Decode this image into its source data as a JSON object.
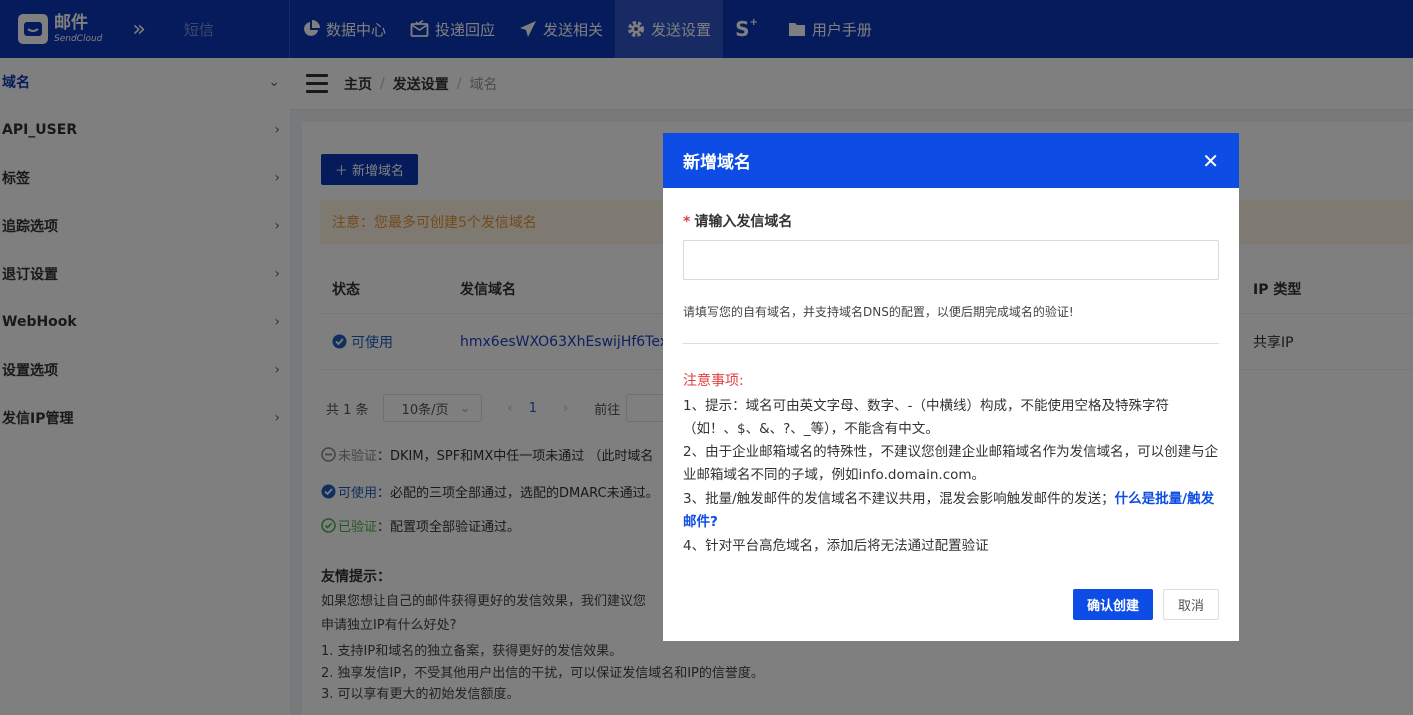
{
  "brand": {
    "name": "邮件",
    "sub": "SendCloud",
    "toggle": "»",
    "sms": "短信"
  },
  "topnav": [
    {
      "label": "数据中心",
      "icon": "pie-chart-icon"
    },
    {
      "label": "投递回应",
      "icon": "mail-check-icon"
    },
    {
      "label": "发送相关",
      "icon": "paper-plane-icon"
    },
    {
      "label": "发送设置",
      "icon": "gear-icon",
      "active": true
    },
    {
      "label": "",
      "icon": "s-plus-icon",
      "glyph": "S"
    },
    {
      "label": "用户手册",
      "icon": "folder-icon"
    }
  ],
  "sidebar": {
    "items": [
      {
        "label": "域名",
        "active": true,
        "chevron": "⌄"
      },
      {
        "label": "API_USER",
        "chevron": "›"
      },
      {
        "label": "标签",
        "chevron": "›"
      },
      {
        "label": "追踪选项",
        "chevron": "›"
      },
      {
        "label": "退订设置",
        "chevron": "›"
      },
      {
        "label": "WebHook",
        "chevron": "›"
      },
      {
        "label": "设置选项",
        "chevron": "›"
      },
      {
        "label": "发信IP管理",
        "chevron": "›"
      }
    ]
  },
  "breadcrumb": {
    "home": "主页",
    "section": "发送设置",
    "current": "域名",
    "sep": "/"
  },
  "main": {
    "add_button": "＋ 新增域名",
    "notice": "注意：您最多可创建5个发信域名",
    "table": {
      "headers": {
        "status": "状态",
        "domain": "发信域名",
        "ip_type": "IP 类型"
      },
      "rows": [
        {
          "status": "可使用",
          "domain": "hmx6esWXO63XhEswijHf6Tex",
          "ip_type": "共享IP"
        }
      ]
    },
    "pager": {
      "total": "共 1 条",
      "page_size": "10条/页",
      "prev": "‹",
      "page": "1",
      "next": "›",
      "goto": "前往"
    },
    "legend": [
      {
        "icon": "minus-circle-icon",
        "term": "未验证",
        "text": "：DKIM，SPF和MX中任一项未通过 （此时域名",
        "color": "#8a8a8a"
      },
      {
        "icon": "check-circle-icon",
        "term": "可使用",
        "text": "：必配的三项全部通过，选配的DMARC未通过。",
        "color": "#1f5fbf"
      },
      {
        "icon": "verified-icon",
        "term": "已验证",
        "text": "：配置项全部验证通过。",
        "color": "#4caf50"
      }
    ],
    "tips": {
      "title": "友情提示：",
      "lines": [
        "如果您想让自己的邮件获得更好的发信效果，我们建议您",
        "申请独立IP有什么好处?",
        "1. 支持IP和域名的独立备案，获得更好的发信效果。",
        "2. 独享发信IP，不受其他用户出信的干扰，可以保证发信域名和IP的信誉度。",
        "3. 可以享有更大的初始发信额度。"
      ]
    }
  },
  "modal": {
    "title": "新增域名",
    "close": "✕",
    "field": {
      "required": "*",
      "label": "请输入发信域名",
      "value": "",
      "placeholder": ""
    },
    "help": "请填写您的自有域名，并支持域名DNS的配置，以便后期完成域名的验证!",
    "notes_title": "注意事项:",
    "notes": [
      "1、提示：域名可由英文字母、数字、-（中横线）构成，不能使用空格及特殊字符（如！、$、&、?、_等），不能含有中文。",
      "2、由于企业邮箱域名的特殊性，不建议您创建企业邮箱域名作为发信域名，可以创建与企业邮箱域名不同的子域，例如info.domain.com。",
      "3、批量/触发邮件的发信域名不建议共用，混发会影响触发邮件的发送；",
      "4、针对平台高危域名，添加后将无法通过配置验证"
    ],
    "note3_link": "什么是批量/触发邮件?",
    "confirm": "确认创建",
    "cancel": "取消"
  },
  "colors": {
    "nav_bg": "#0d36b6",
    "modal_head": "#0d4de6",
    "notice_text": "#e6953b",
    "danger": "#e04040"
  }
}
